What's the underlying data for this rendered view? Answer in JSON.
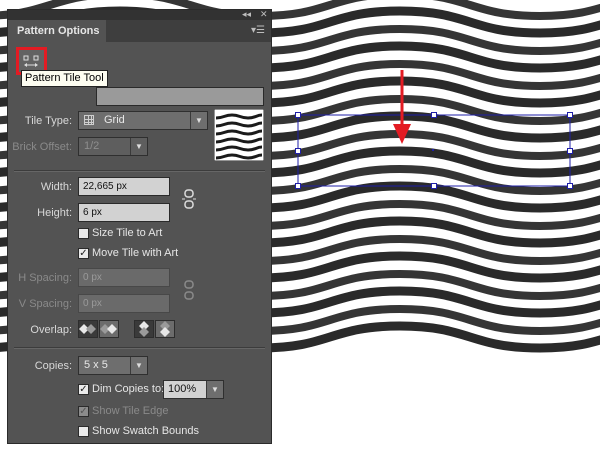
{
  "panel": {
    "title": "Pattern Options",
    "tooltip": "Pattern Tile Tool",
    "icons": [
      "collapse-icon",
      "close-icon",
      "panel-menu-icon",
      "pattern-tile-tool-icon",
      "grid-icon",
      "chevron-down-icon",
      "chain-link-icon"
    ]
  },
  "tile_type": {
    "label": "Tile Type:",
    "value": "Grid"
  },
  "brick_offset": {
    "label": "Brick Offset:",
    "value": "1/2"
  },
  "size": {
    "width_label": "Width:",
    "width_value": "22,665 px",
    "height_label": "Height:",
    "height_value": "6 px"
  },
  "checks": {
    "size_tile_to_art": {
      "label": "Size Tile to Art",
      "checked": false
    },
    "move_tile_with_art": {
      "label": "Move Tile with Art",
      "checked": true
    }
  },
  "spacing": {
    "h_label": "H Spacing:",
    "h_value": "0 px",
    "v_label": "V Spacing:",
    "v_value": "0 px"
  },
  "overlap": {
    "label": "Overlap:"
  },
  "copies": {
    "label": "Copies:",
    "value": "5 x 5",
    "dim_label": "Dim Copies to:",
    "dim_checked": true,
    "dim_value": "100%",
    "show_tile_edge": {
      "label": "Show Tile Edge",
      "checked": true
    },
    "show_swatch_bounds": {
      "label": "Show Swatch Bounds",
      "checked": false
    }
  },
  "colors": {
    "panel": "#535353",
    "highlight": "#e31b23",
    "selection": "#1f1fa8",
    "stripe": "#2a2a2a"
  }
}
